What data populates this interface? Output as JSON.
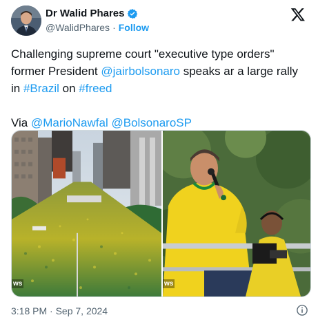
{
  "author": {
    "name": "Dr Walid Phares",
    "handle": "@WalidPhares",
    "separator": "·",
    "follow_label": "Follow",
    "avatar_icon": "profile-photo",
    "verified_icon": "verified-badge-icon"
  },
  "tweet": {
    "segments": [
      {
        "text": "Challenging supreme court \"executive type orders\" former President ",
        "link": false
      },
      {
        "text": "@jairbolsonaro",
        "link": true
      },
      {
        "text": " speaks ar a large rally in ",
        "link": false
      },
      {
        "text": "#Brazil",
        "link": true
      },
      {
        "text": " on ",
        "link": false
      },
      {
        "text": "#freed",
        "link": true
      }
    ],
    "via_label": "Via ",
    "via_mentions": [
      "@MarioNawfal",
      "@BolsonaroSP"
    ]
  },
  "media": {
    "left_badge": "ws",
    "right_badge": "ws"
  },
  "timestamp": "3:18 PM · Sep 7, 2024",
  "colors": {
    "link": "#1d9bf0",
    "muted": "#536471",
    "text": "#0f1419"
  }
}
